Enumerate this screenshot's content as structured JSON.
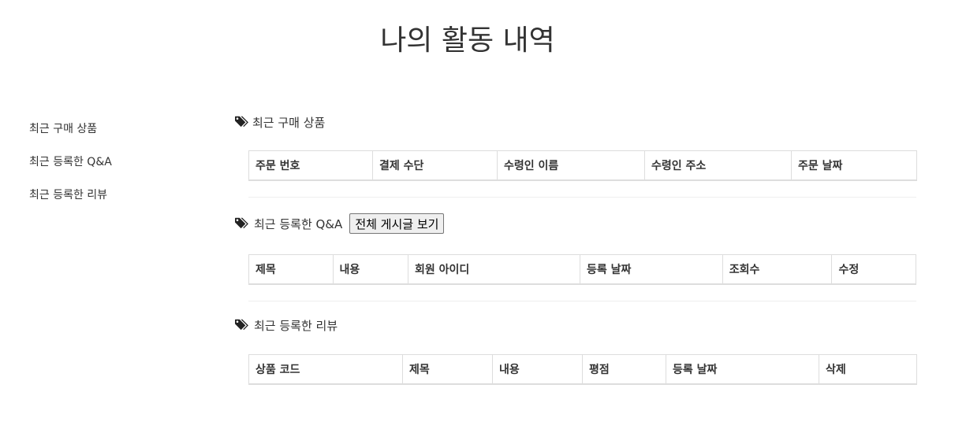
{
  "title": "나의 활동 내역",
  "sidebar": {
    "items": [
      {
        "label": "최근 구매 상품"
      },
      {
        "label": "최근 등록한 Q&A"
      },
      {
        "label": "최근 등록한 리뷰"
      }
    ]
  },
  "sections": {
    "orders": {
      "heading": "최근 구매 상품",
      "icon": "tags-icon",
      "columns": [
        "주문 번호",
        "결제 수단",
        "수령인 이름",
        "수령인 주소",
        "주문 날짜"
      ]
    },
    "qna": {
      "heading": "최근 등록한 Q&A",
      "icon": "tags-icon",
      "button_label": "전체 게시글 보기",
      "columns": [
        "제목",
        "내용",
        "회원 아이디",
        "등록 날짜",
        "조회수",
        "수정"
      ]
    },
    "reviews": {
      "heading": "최근 등록한 리뷰",
      "icon": "tags-icon",
      "columns": [
        "상품 코드",
        "제목",
        "내용",
        "평점",
        "등록 날짜",
        "삭제"
      ]
    }
  }
}
